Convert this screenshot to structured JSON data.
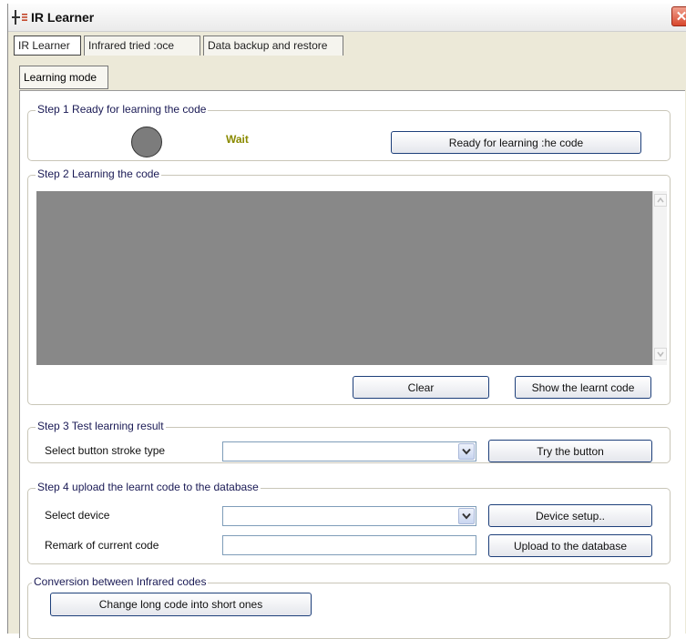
{
  "window": {
    "title": "IR Learner",
    "close_glyph": "✕"
  },
  "tabs": [
    {
      "label": "IR Learner"
    },
    {
      "label": "Infrared tried :oce"
    },
    {
      "label": "Data backup and restore"
    }
  ],
  "subtab": {
    "label": "Learning mode"
  },
  "step1": {
    "legend": "Step 1  Ready for learning the code",
    "status": "Wait",
    "status_color": "#8a8a00",
    "indicator_color": "#7c7c7c",
    "ready_button": "Ready for learning :he code"
  },
  "step2": {
    "legend": "Step 2  Learning the code",
    "code_text": "",
    "clear_button": "Clear",
    "show_button": "Show the learnt code"
  },
  "step3": {
    "legend": "Step 3  Test learning result",
    "stroke_label": "Select button stroke type",
    "stroke_value": "",
    "try_button": "Try the button"
  },
  "step4": {
    "legend": "Step 4  upload the learnt code to the database",
    "device_label": "Select device",
    "device_value": "",
    "device_setup_button": "Device setup..",
    "remark_label": "Remark of current code",
    "remark_value": "",
    "upload_button": "Upload to the database"
  },
  "conversion": {
    "legend": "Conversion between Infrared codes",
    "convert_button": "Change long code into short ones"
  },
  "colors": {
    "panel_bg": "#ece9d8",
    "button_border": "#1d3f7a",
    "code_area": "#888888"
  }
}
